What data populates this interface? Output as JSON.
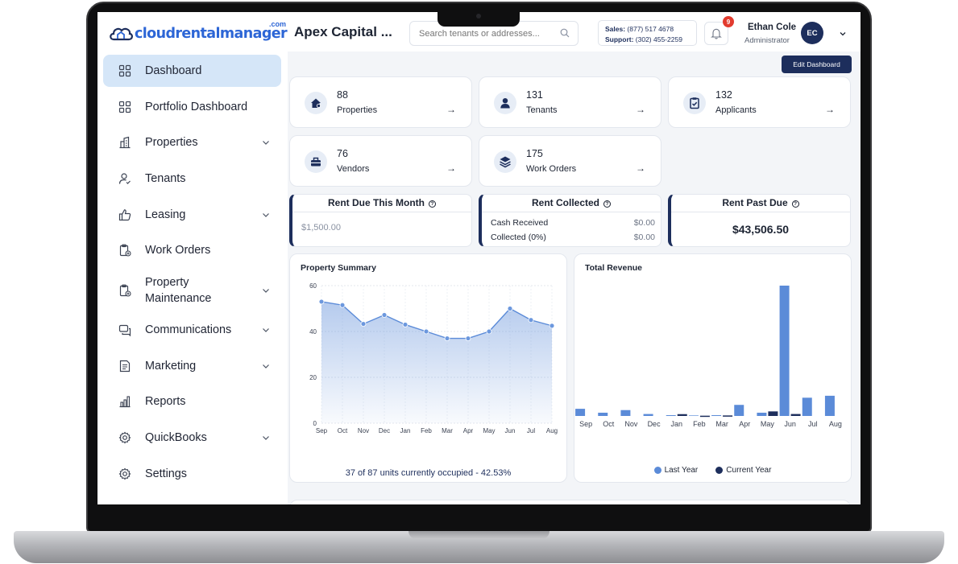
{
  "brand": {
    "logo_text": "cloudrentalmanager",
    "logo_suffix": ".com"
  },
  "sidebar": {
    "items": [
      {
        "label": "Dashboard",
        "icon": "grid-icon",
        "active": true,
        "chevron": false
      },
      {
        "label": "Portfolio Dashboard",
        "icon": "grid-icon",
        "active": false,
        "chevron": false
      },
      {
        "label": "Properties",
        "icon": "buildings-icon",
        "active": false,
        "chevron": true
      },
      {
        "label": "Tenants",
        "icon": "person-check-icon",
        "active": false,
        "chevron": false
      },
      {
        "label": "Leasing",
        "icon": "thumbs-up-icon",
        "active": false,
        "chevron": true
      },
      {
        "label": "Work Orders",
        "icon": "clipboard-plus-icon",
        "active": false,
        "chevron": false
      },
      {
        "label": "Property Maintenance",
        "icon": "clipboard-plus-icon",
        "active": false,
        "chevron": true
      },
      {
        "label": "Communications",
        "icon": "chat-icon",
        "active": false,
        "chevron": true
      },
      {
        "label": "Marketing",
        "icon": "document-icon",
        "active": false,
        "chevron": true
      },
      {
        "label": "Reports",
        "icon": "bar-chart-icon",
        "active": false,
        "chevron": false
      },
      {
        "label": "QuickBooks",
        "icon": "gear-icon",
        "active": false,
        "chevron": true
      },
      {
        "label": "Settings",
        "icon": "gear-icon",
        "active": false,
        "chevron": false
      }
    ]
  },
  "header": {
    "company": "Apex Capital ...",
    "search_placeholder": "Search tenants or addresses...",
    "sales_label": "Sales:",
    "sales_phone": "(877) 517 4678",
    "support_label": "Support:",
    "support_phone": "(302) 455-2259",
    "notification_count": "9",
    "user_name": "Ethan Cole",
    "user_role": "Administrator",
    "user_initials": "EC"
  },
  "main": {
    "edit_label": "Edit Dashboard",
    "stats": [
      {
        "value": "88",
        "label": "Properties",
        "icon": "house-icon"
      },
      {
        "value": "131",
        "label": "Tenants",
        "icon": "user-icon"
      },
      {
        "value": "132",
        "label": "Applicants",
        "icon": "clipboard-check-icon"
      },
      {
        "value": "76",
        "label": "Vendors",
        "icon": "toolbox-icon"
      },
      {
        "value": "175",
        "label": "Work Orders",
        "icon": "layers-icon"
      }
    ],
    "arrow": "→",
    "rent_due": {
      "title": "Rent Due This Month",
      "amount": "$1,500.00"
    },
    "rent_collected": {
      "title": "Rent Collected",
      "cash_label": "Cash Received",
      "cash_value": "$0.00",
      "collected_label": "Collected (0%)",
      "collected_value": "$0.00"
    },
    "rent_past_due": {
      "title": "Rent Past Due",
      "amount": "$43,506.50"
    },
    "property_summary": {
      "title": "Property Summary",
      "footer": "37 of 87 units currently occupied - 42.53%"
    },
    "total_revenue": {
      "title": "Total Revenue",
      "legend_last": "Last Year",
      "legend_current": "Current Year"
    }
  },
  "colors": {
    "navy": "#1d2e5c",
    "blue": "#5b8bd8",
    "accent_bg": "#d5e6f8",
    "badge": "#e23b2e"
  },
  "chart_data": [
    {
      "type": "area",
      "title": "Property Summary",
      "x": [
        "Sep",
        "Oct",
        "Nov",
        "Dec",
        "Jan",
        "Feb",
        "Mar",
        "Apr",
        "May",
        "Jun",
        "Jul",
        "Aug"
      ],
      "values": [
        53,
        51.5,
        43.3,
        47.2,
        43,
        40,
        37,
        37,
        40,
        50,
        45,
        42.5
      ],
      "yticks": [
        0,
        20,
        40,
        60
      ],
      "ylim": [
        0,
        60
      ],
      "grid": true
    },
    {
      "type": "bar",
      "title": "Total Revenue",
      "categories": [
        "Sep",
        "Oct",
        "Nov",
        "Dec",
        "Jan",
        "Feb",
        "Mar",
        "Apr",
        "May",
        "Jun",
        "Jul",
        "Aug"
      ],
      "series": [
        {
          "name": "Last Year",
          "color": "#5b8bd8",
          "values": [
            5.5,
            2.5,
            4.5,
            1.5,
            0.6,
            0.4,
            0.6,
            8.5,
            2.5,
            100,
            14,
            15.5
          ]
        },
        {
          "name": "Current Year",
          "color": "#1d2e5c",
          "values": [
            0,
            0,
            0,
            0,
            1.4,
            0.2,
            0.4,
            0,
            3.5,
            1.5,
            0,
            0
          ]
        }
      ],
      "legend": "bottom"
    }
  ]
}
